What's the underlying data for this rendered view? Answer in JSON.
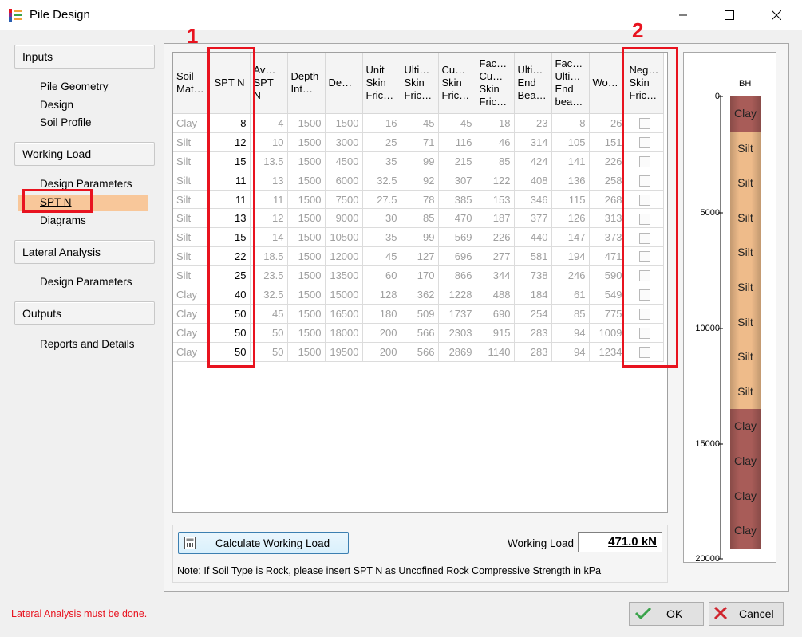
{
  "window": {
    "title": "Pile Design"
  },
  "sidebar": {
    "inputs": {
      "label": "Inputs",
      "items": [
        "Pile Geometry",
        "Design",
        "Soil Profile"
      ]
    },
    "working_load": {
      "label": "Working Load",
      "items": [
        "Design Parameters",
        "SPT N",
        "Diagrams"
      ]
    },
    "lateral": {
      "label": "Lateral Analysis",
      "items": [
        "Design Parameters"
      ]
    },
    "outputs": {
      "label": "Outputs",
      "items": [
        "Reports and Details"
      ]
    }
  },
  "annotations": {
    "label_1": "1",
    "label_2": "2"
  },
  "grid": {
    "headers": [
      "Soil Mat…",
      "SPT N",
      "Av… SPT N",
      "Depth Int…",
      "De…",
      "Unit Skin Fric…",
      "Ulti… Skin Fric…",
      "Cu… Skin Fric…",
      "Fac… Cu… Skin Fric…",
      "Ulti… End Bea…",
      "Fac… Ulti… End bea…",
      "Wo…",
      "Neg… Skin Fric…"
    ],
    "rows": [
      [
        "Clay",
        "8",
        "4",
        "1500",
        "1500",
        "16",
        "45",
        "45",
        "18",
        "23",
        "8",
        "26"
      ],
      [
        "Silt",
        "12",
        "10",
        "1500",
        "3000",
        "25",
        "71",
        "116",
        "46",
        "314",
        "105",
        "151"
      ],
      [
        "Silt",
        "15",
        "13.5",
        "1500",
        "4500",
        "35",
        "99",
        "215",
        "85",
        "424",
        "141",
        "226"
      ],
      [
        "Silt",
        "11",
        "13",
        "1500",
        "6000",
        "32.5",
        "92",
        "307",
        "122",
        "408",
        "136",
        "258"
      ],
      [
        "Silt",
        "11",
        "11",
        "1500",
        "7500",
        "27.5",
        "78",
        "385",
        "153",
        "346",
        "115",
        "268"
      ],
      [
        "Silt",
        "13",
        "12",
        "1500",
        "9000",
        "30",
        "85",
        "470",
        "187",
        "377",
        "126",
        "313"
      ],
      [
        "Silt",
        "15",
        "14",
        "1500",
        "10500",
        "35",
        "99",
        "569",
        "226",
        "440",
        "147",
        "373"
      ],
      [
        "Silt",
        "22",
        "18.5",
        "1500",
        "12000",
        "45",
        "127",
        "696",
        "277",
        "581",
        "194",
        "471"
      ],
      [
        "Silt",
        "25",
        "23.5",
        "1500",
        "13500",
        "60",
        "170",
        "866",
        "344",
        "738",
        "246",
        "590"
      ],
      [
        "Clay",
        "40",
        "32.5",
        "1500",
        "15000",
        "128",
        "362",
        "1228",
        "488",
        "184",
        "61",
        "549"
      ],
      [
        "Clay",
        "50",
        "45",
        "1500",
        "16500",
        "180",
        "509",
        "1737",
        "690",
        "254",
        "85",
        "775"
      ],
      [
        "Clay",
        "50",
        "50",
        "1500",
        "18000",
        "200",
        "566",
        "2303",
        "915",
        "283",
        "94",
        "1009"
      ],
      [
        "Clay",
        "50",
        "50",
        "1500",
        "19500",
        "200",
        "566",
        "2869",
        "1140",
        "283",
        "94",
        "1234"
      ]
    ]
  },
  "borehole": {
    "header": "BH",
    "ticks": [
      "0",
      "5000",
      "10000",
      "15000",
      "20000"
    ],
    "layers": [
      "Clay",
      "Silt",
      "Silt",
      "Silt",
      "Silt",
      "Silt",
      "Silt",
      "Silt",
      "Silt",
      "Clay",
      "Clay",
      "Clay",
      "Clay"
    ],
    "colors": {
      "clay": "#a85c58",
      "silt": "#eebb8a"
    }
  },
  "bottom": {
    "calc_button": "Calculate Working Load",
    "working_load_label": "Working Load",
    "working_load_value": "471.0 kN",
    "note": "Note: If Soil Type is Rock, please insert SPT N as Uncofined Rock Compressive Strength in kPa"
  },
  "footer": {
    "status": "Lateral Analysis must be done.",
    "ok": "OK",
    "cancel": "Cancel"
  }
}
